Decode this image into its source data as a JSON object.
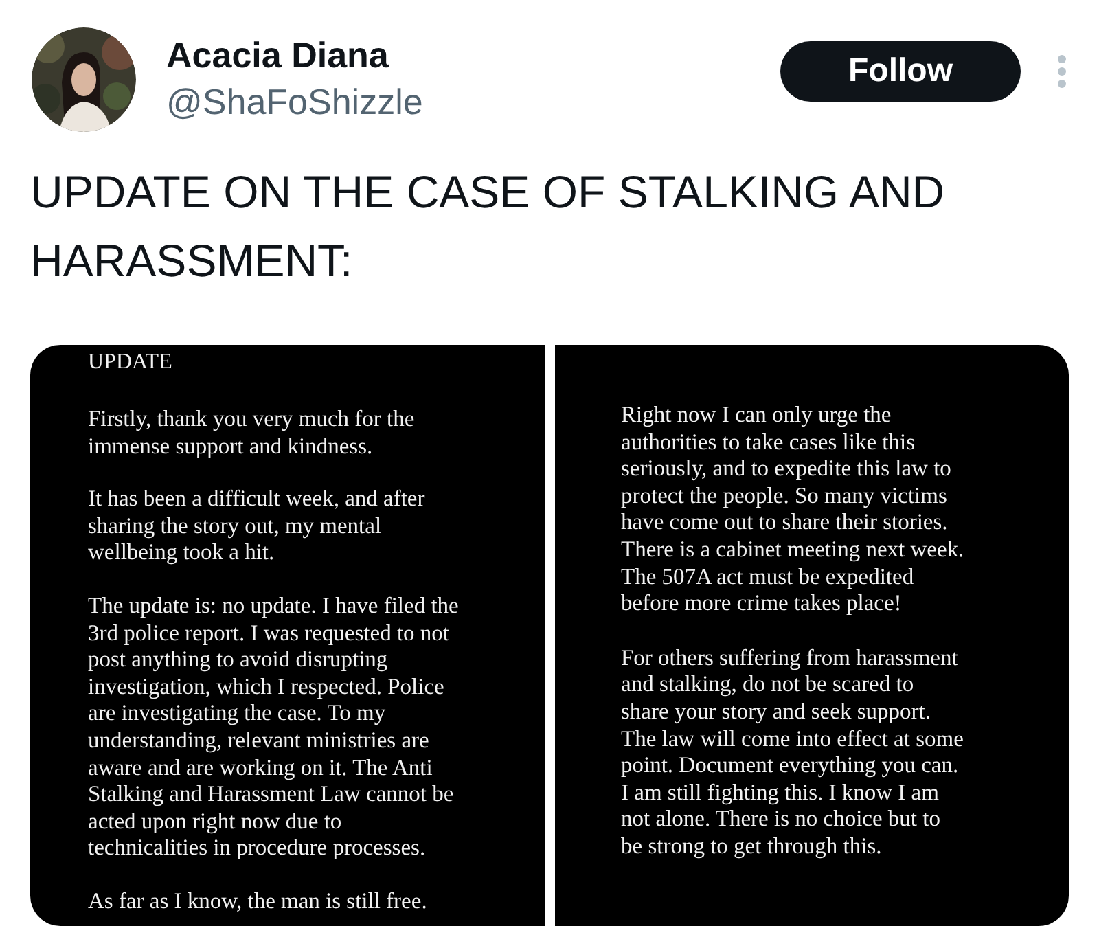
{
  "author": {
    "name": "Acacia Diana",
    "handle": "@ShaFoShizzle"
  },
  "follow_button": "Follow",
  "tweet_text": [
    "UPDATE ON THE CASE OF STALKING AND",
    "HARASSMENT:"
  ],
  "images": [
    {
      "heading": "UPDATE",
      "paragraphs": [
        [
          "Firstly, thank you very much for the",
          "immense support and kindness."
        ],
        [
          "It has been a difficult week, and after",
          "sharing the story out, my mental",
          "wellbeing took a hit."
        ],
        [
          "The update is: no update. I have filed the",
          "3rd police report. I was requested to not",
          "post anything to avoid disrupting",
          "investigation, which I respected. Police",
          "are investigating the case. To my",
          "understanding, relevant ministries are",
          "aware and are working on it. The Anti",
          "Stalking and Harassment Law cannot be",
          "acted upon right now due to",
          "technicalities in procedure processes."
        ],
        [
          "As far as I know, the man is still free."
        ]
      ]
    },
    {
      "paragraphs": [
        [
          "Right now I can only urge the",
          "authorities to take cases like this",
          "seriously, and to expedite this law to",
          "protect the people. So many victims",
          "have come out to share their stories.",
          "There is a cabinet meeting next week.",
          "The 507A act must be expedited",
          "before more crime takes place!"
        ],
        [
          "For others suffering from harassment",
          "and stalking, do not be scared to",
          "share your story and seek support.",
          "The law will come into effect at some",
          "point. Document everything you can.",
          "I am still fighting this. I know I am",
          "not alone. There is no choice but to",
          "be strong to get through this."
        ]
      ]
    }
  ]
}
